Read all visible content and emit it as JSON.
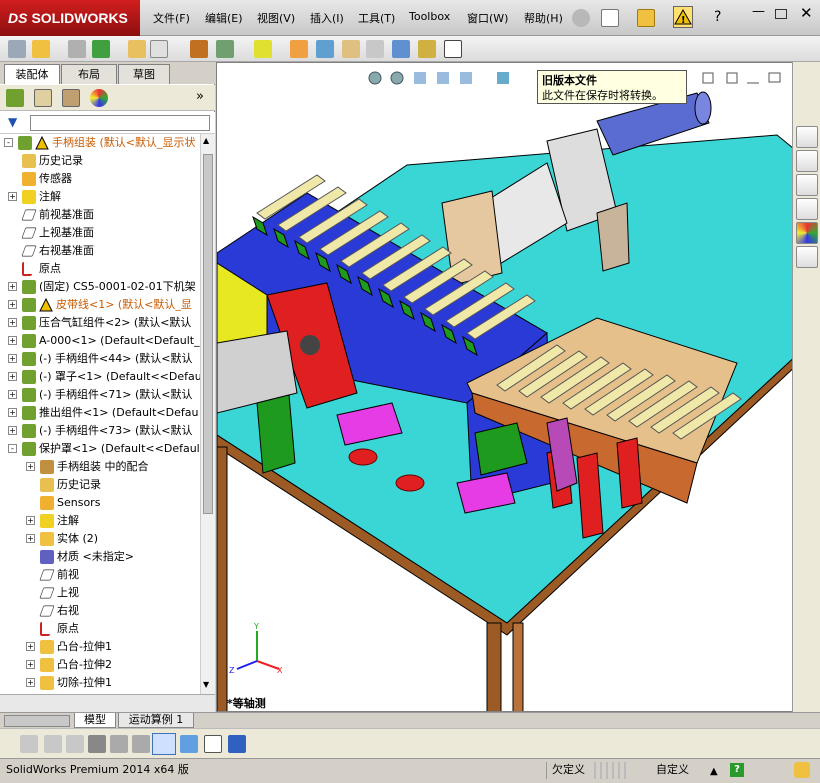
{
  "app": {
    "logo": "SOLIDWORKS"
  },
  "menu": [
    "文件(F)",
    "编辑(E)",
    "视图(V)",
    "插入(I)",
    "工具(T)",
    "Toolbox",
    "窗口(W)",
    "帮助(H)"
  ],
  "left_tabs": [
    "装配体",
    "布局",
    "草图"
  ],
  "tree": [
    {
      "label": "手柄组装  (默认<默认_显示状",
      "level": 0,
      "exp": "-",
      "icon": "assembly-warning-icon",
      "color": "#c85a00",
      "warn": true
    },
    {
      "label": "历史记录",
      "level": 1,
      "exp": "",
      "icon": "history-icon"
    },
    {
      "label": "传感器",
      "level": 1,
      "exp": "",
      "icon": "sensor-icon"
    },
    {
      "label": "注解",
      "level": 1,
      "exp": "+",
      "icon": "annotation-icon"
    },
    {
      "label": "前视基准面",
      "level": 1,
      "exp": "",
      "icon": "plane-icon"
    },
    {
      "label": "上视基准面",
      "level": 1,
      "exp": "",
      "icon": "plane-icon"
    },
    {
      "label": "右视基准面",
      "level": 1,
      "exp": "",
      "icon": "plane-icon"
    },
    {
      "label": "原点",
      "level": 1,
      "exp": "",
      "icon": "origin-icon"
    },
    {
      "label": "(固定) CS5-0001-02-01下机架",
      "level": 1,
      "exp": "+",
      "icon": "assembly-icon"
    },
    {
      "label": "皮带线<1> (默认<默认_显",
      "level": 1,
      "exp": "+",
      "icon": "assembly-warning-icon",
      "color": "#c85a00",
      "warn": true
    },
    {
      "label": "压合气缸组件<2> (默认<默认",
      "level": 1,
      "exp": "+",
      "icon": "assembly-icon"
    },
    {
      "label": "A-000<1> (Default<Default_",
      "level": 1,
      "exp": "+",
      "icon": "assembly-icon"
    },
    {
      "label": "(-) 手柄组件<44> (默认<默认",
      "level": 1,
      "exp": "+",
      "icon": "assembly-icon"
    },
    {
      "label": "(-) 罩子<1> (Default<<Defaul",
      "level": 1,
      "exp": "+",
      "icon": "assembly-icon"
    },
    {
      "label": "(-) 手柄组件<71> (默认<默认",
      "level": 1,
      "exp": "+",
      "icon": "assembly-icon"
    },
    {
      "label": "推出组件<1> (Default<Defau",
      "level": 1,
      "exp": "+",
      "icon": "assembly-icon"
    },
    {
      "label": "(-) 手柄组件<73> (默认<默认",
      "level": 1,
      "exp": "+",
      "icon": "assembly-icon"
    },
    {
      "label": "保护罩<1> (Default<<Defaul",
      "level": 1,
      "exp": "-",
      "icon": "assembly-icon"
    },
    {
      "label": "手柄组装 中的配合",
      "level": 2,
      "exp": "+",
      "icon": "mates-icon"
    },
    {
      "label": "历史记录",
      "level": 2,
      "exp": "",
      "icon": "history-icon"
    },
    {
      "label": "Sensors",
      "level": 2,
      "exp": "",
      "icon": "sensor-icon"
    },
    {
      "label": "注解",
      "level": 2,
      "exp": "+",
      "icon": "annotation-icon"
    },
    {
      "label": "实体 (2)",
      "level": 2,
      "exp": "+",
      "icon": "solid-body-icon"
    },
    {
      "label": "材质 <未指定>",
      "level": 2,
      "exp": "",
      "icon": "material-icon"
    },
    {
      "label": "前视",
      "level": 2,
      "exp": "",
      "icon": "plane-icon"
    },
    {
      "label": "上视",
      "level": 2,
      "exp": "",
      "icon": "plane-icon"
    },
    {
      "label": "右视",
      "level": 2,
      "exp": "",
      "icon": "plane-icon"
    },
    {
      "label": "原点",
      "level": 2,
      "exp": "",
      "icon": "origin-icon"
    },
    {
      "label": "凸台-拉伸1",
      "level": 2,
      "exp": "+",
      "icon": "extrude-icon"
    },
    {
      "label": "凸台-拉伸2",
      "level": 2,
      "exp": "+",
      "icon": "extrude-icon"
    },
    {
      "label": "切除-拉伸1",
      "level": 2,
      "exp": "+",
      "icon": "cut-extrude-icon"
    }
  ],
  "tooltip": {
    "title": "旧版本文件",
    "body": "此文件在保存时将转换。"
  },
  "view_label": "*等轴测",
  "bottom_tabs": [
    "模型",
    "运动算例 1"
  ],
  "status": {
    "app": "SolidWorks Premium 2014 x64 版",
    "state": "欠定义",
    "custom": "自定义"
  },
  "colors": {
    "base": "#3ad6d6",
    "frame": "#9c5a24",
    "conveyor": "#2a3ad6",
    "handles": "#f0e8a8",
    "green": "#1e9a1e",
    "red": "#e02020",
    "pink": "#e63ce6"
  }
}
